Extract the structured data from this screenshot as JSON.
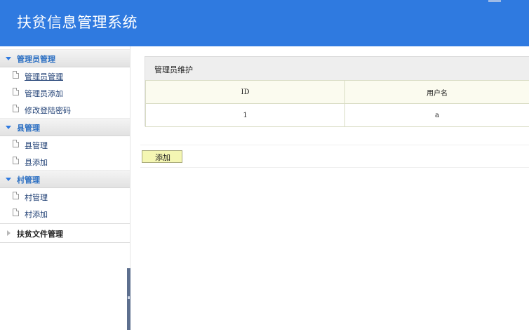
{
  "app": {
    "title": "扶贫信息管理系统"
  },
  "sidebar": {
    "groups": [
      {
        "label": "管理员管理",
        "items": [
          {
            "label": "管理员管理"
          },
          {
            "label": "管理员添加"
          },
          {
            "label": "修改登陆密码"
          }
        ]
      },
      {
        "label": "县管理",
        "items": [
          {
            "label": "县管理"
          },
          {
            "label": "县添加"
          }
        ]
      },
      {
        "label": "村管理",
        "items": [
          {
            "label": "村管理"
          },
          {
            "label": "村添加"
          }
        ]
      },
      {
        "label": "扶贫文件管理",
        "items": []
      }
    ]
  },
  "main": {
    "panel_title": "管理员维护",
    "table": {
      "columns": [
        "ID",
        "用户名"
      ],
      "rows": [
        [
          "1",
          "a"
        ]
      ]
    },
    "add_button": "添加"
  },
  "colors": {
    "header_bg": "#2f7ae0",
    "group_label": "#2a6ec2",
    "table_header_bg": "#fbfbef",
    "button_bg": "#f4f6b3"
  }
}
